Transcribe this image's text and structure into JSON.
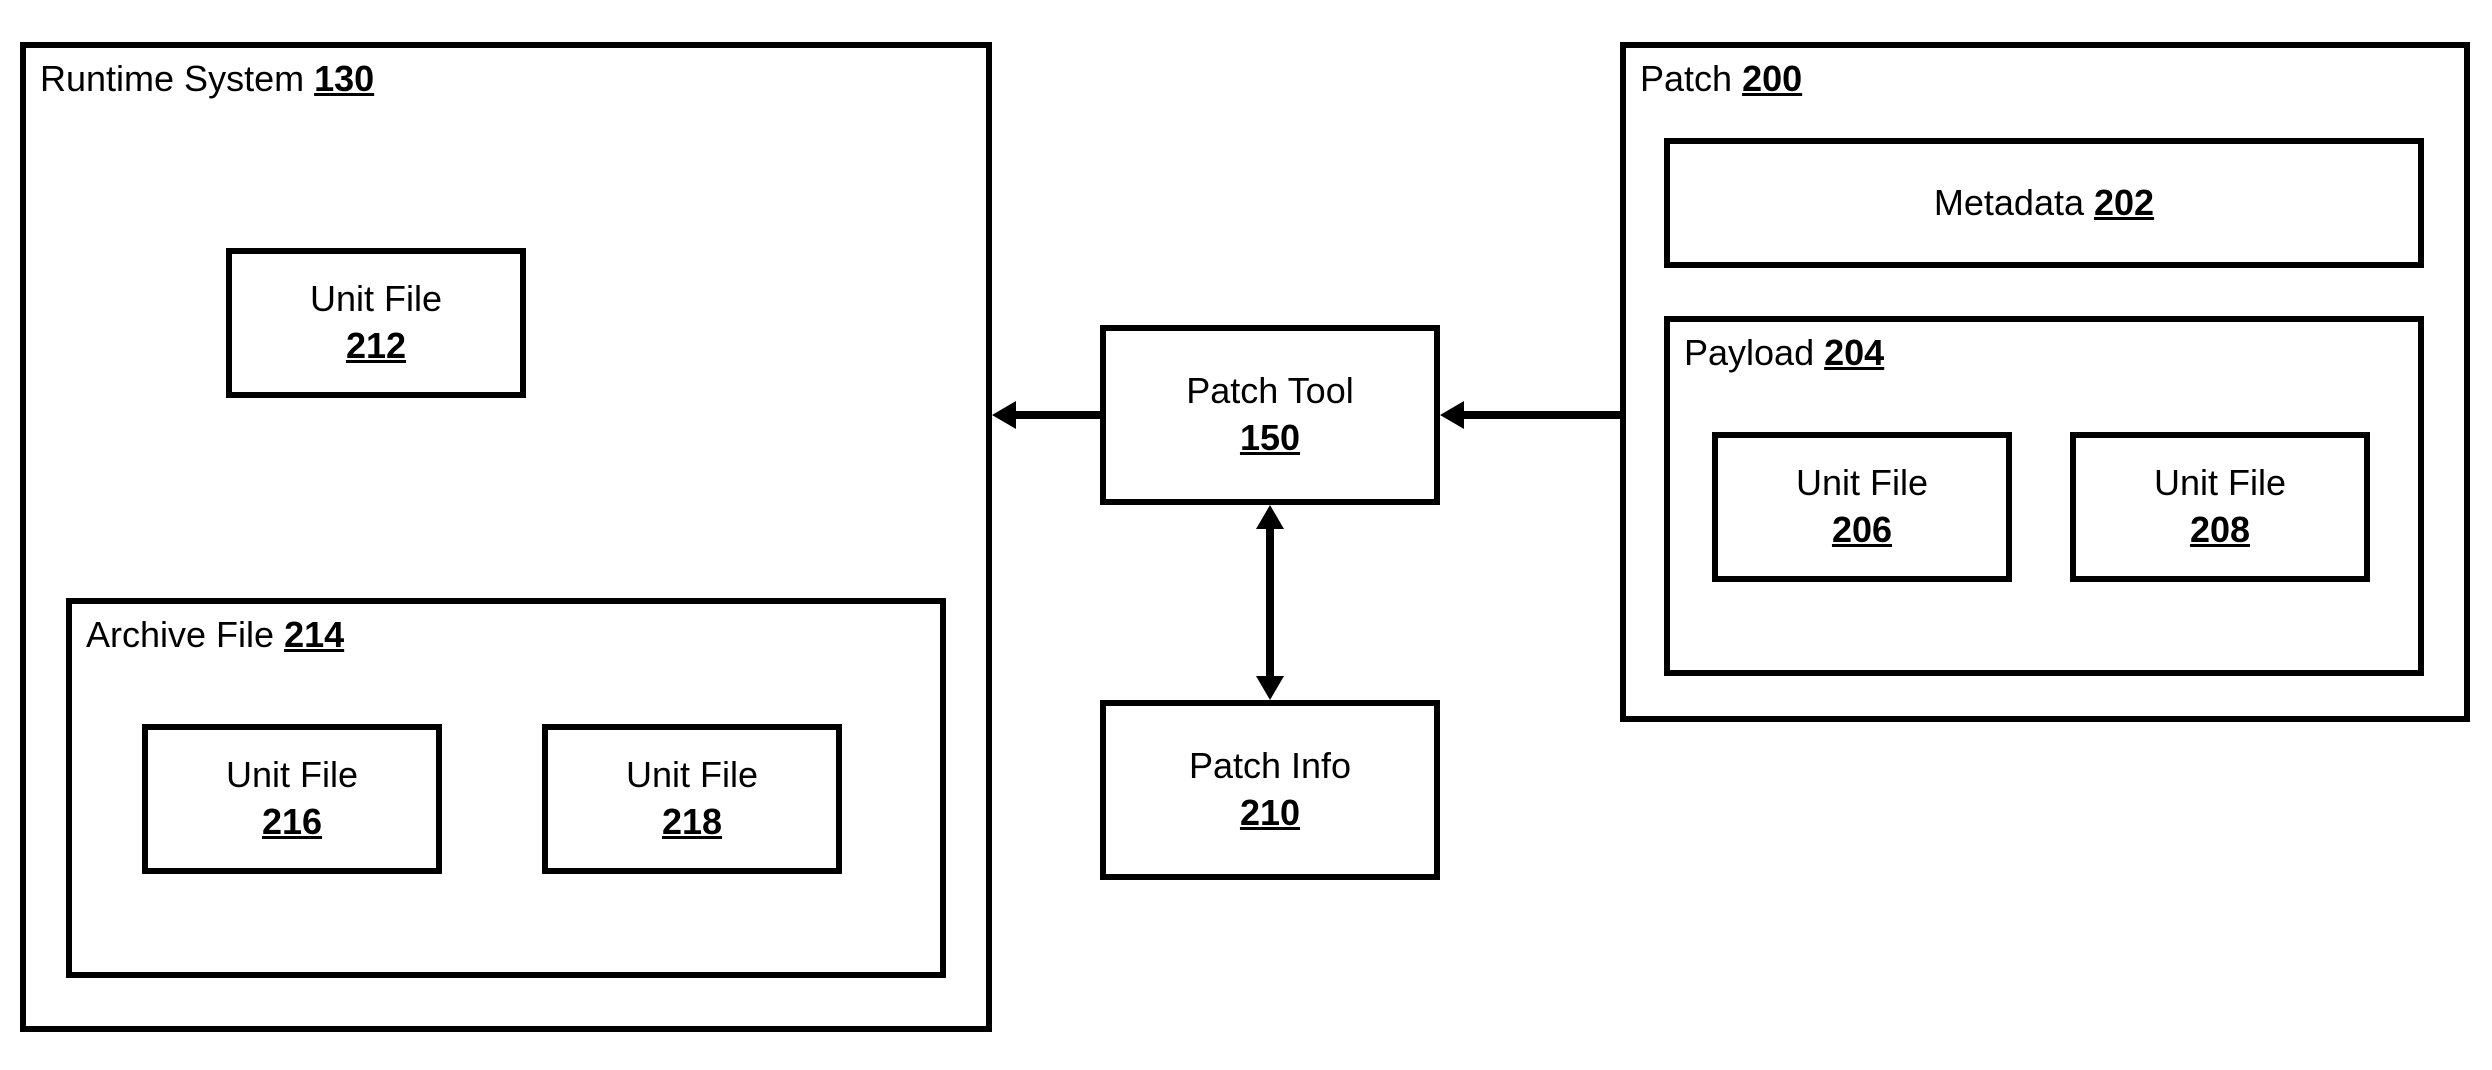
{
  "runtimeSystem": {
    "label": "Runtime System",
    "ref": "130",
    "unitFile1": {
      "label": "Unit File",
      "ref": "212"
    },
    "archiveFile": {
      "label": "Archive File",
      "ref": "214",
      "unitFile1": {
        "label": "Unit File",
        "ref": "216"
      },
      "unitFile2": {
        "label": "Unit File",
        "ref": "218"
      }
    }
  },
  "patchTool": {
    "label": "Patch Tool",
    "ref": "150"
  },
  "patchInfo": {
    "label": "Patch Info",
    "ref": "210"
  },
  "patch": {
    "label": "Patch",
    "ref": "200",
    "metadata": {
      "label": "Metadata",
      "ref": "202"
    },
    "payload": {
      "label": "Payload",
      "ref": "204",
      "unitFile1": {
        "label": "Unit File",
        "ref": "206"
      },
      "unitFile2": {
        "label": "Unit File",
        "ref": "208"
      }
    }
  }
}
